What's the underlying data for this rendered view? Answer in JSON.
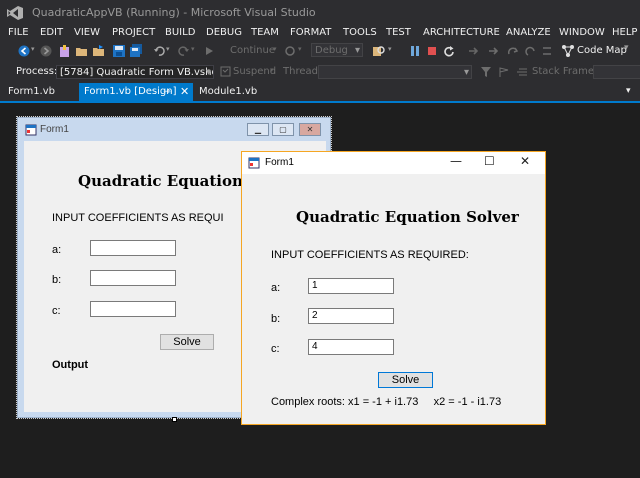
{
  "window": {
    "title": "QuadraticAppVB (Running) - Microsoft Visual Studio"
  },
  "menu": {
    "items": [
      "FILE",
      "EDIT",
      "VIEW",
      "PROJECT",
      "BUILD",
      "DEBUG",
      "TEAM",
      "FORMAT",
      "TOOLS",
      "TEST",
      "ARCHITECTURE",
      "ANALYZE",
      "WINDOW",
      "HELP"
    ]
  },
  "toolbar": {
    "continue_label": "Continue",
    "config_value": "Debug",
    "code_map_label": "Code Map",
    "process_label": "Process:",
    "process_value": "[5784] Quadratic Form VB.vshost.e",
    "suspend_label": "Suspend",
    "thread_label": "Thread:",
    "stack_frame_label": "Stack Frame:"
  },
  "tabs": [
    {
      "label": "Form1.vb"
    },
    {
      "label": "Form1.vb [Design]"
    },
    {
      "label": "Module1.vb"
    }
  ],
  "design_form": {
    "title": "Form1",
    "heading": "Quadratic Equation S",
    "instruction": "INPUT COEFFICIENTS AS REQUI",
    "label_a": "a:",
    "label_b": "b:",
    "label_c": "c:",
    "solve_label": "Solve",
    "output_label": "Output"
  },
  "running_form": {
    "title": "Form1",
    "heading": "Quadratic Equation Solver",
    "instruction": "INPUT COEFFICIENTS AS REQUIRED:",
    "label_a": "a:",
    "label_b": "b:",
    "label_c": "c:",
    "value_a": "1",
    "value_b": "2",
    "value_c": "4",
    "solve_label": "Solve",
    "result": "Complex roots: x1 = -1 + i1.73     x2 = -1 - i1.73"
  },
  "icons": [
    "visual-studio-logo-icon",
    "back-icon",
    "forward-icon",
    "new-project-icon",
    "open-icon",
    "save-icon",
    "save-all-icon",
    "undo-icon",
    "redo-icon",
    "continue-icon",
    "break-all-icon",
    "stop-icon",
    "restart-icon",
    "step-icon",
    "code-map-icon",
    "process-icon",
    "filter-icon",
    "form-app-icon",
    "minimize-icon",
    "maximize-icon",
    "close-icon",
    "pin-icon"
  ],
  "colors": {
    "vs_chrome": "#2d2d30",
    "vs_accent": "#007acc",
    "designer_bg": "#1e1e1e",
    "form_highlight": "#f5a623"
  }
}
